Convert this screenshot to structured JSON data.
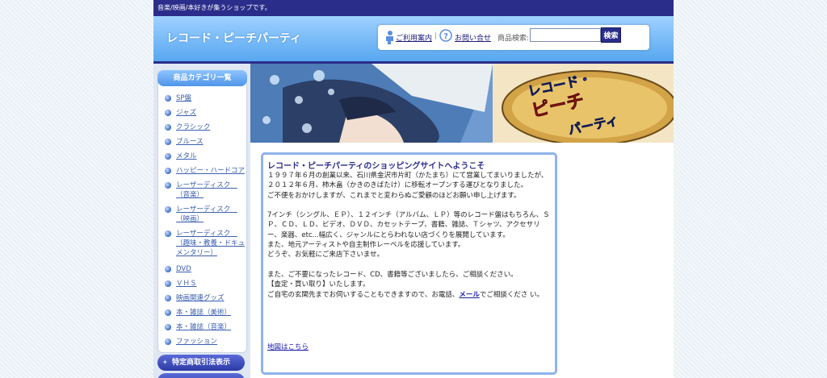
{
  "topbar": {
    "tagline": "音楽/映画/本好きが集うショップです。"
  },
  "header": {
    "logo": "レコード・ピーチパーティ",
    "guide_link": "ご利用案内",
    "contact_link": "お問い合せ",
    "search_label": "商品検索:",
    "search_value": "",
    "search_button": "検索"
  },
  "sidebar": {
    "category_title": "商品カテゴリ一覧",
    "items": [
      {
        "label": "SP盤"
      },
      {
        "label": "ジャズ"
      },
      {
        "label": "クラシック"
      },
      {
        "label": "ブルース"
      },
      {
        "label": "メタル"
      },
      {
        "label": "ハッピー・ハードコア"
      },
      {
        "label": "レーザーディスク　（音楽）"
      },
      {
        "label": "レーザーディスク　（映画）"
      },
      {
        "label": "レーザーディスク　（趣味・教養・ドキュメンタリー）"
      },
      {
        "label": "DVD"
      },
      {
        "label": "ＶＨＳ"
      },
      {
        "label": "映画関連グッズ"
      },
      {
        "label": "本・雑誌（美術）"
      },
      {
        "label": "本・雑誌（音楽）"
      },
      {
        "label": "ファッション"
      }
    ],
    "legal_button": "特定商取引法表示"
  },
  "banner": {
    "logo_text_1": "レコード・",
    "logo_text_2": "ピーチ",
    "logo_text_3": "パーティ"
  },
  "main": {
    "title": "レコード・ピーチパーティのショッピングサイトへようこそ",
    "p1_l1": "１９９７年６月の創業以来、石川県金沢市片町（かたまち）にて営業してまいりましたが、",
    "p1_l2": "２０１２年６月、柿木畠（かきのきばたけ）に移転オープンする運びとなりました。",
    "p1_l3": "ご不便をおかけしますが、これまでと変わらぬご愛顧のほどお願い申し上げます。",
    "p2_l1": "7インチ（シングル、ＥＰ）、１２インチ（アルバム、ＬＰ）等のレコード盤はもちろん、ＳＰ、ＣＤ、ＬＤ、ビデオ、ＤＶＤ、カセットテープ、書籍、雑誌、Ｔシャツ、アクセサリー、楽器、etc...幅広く、ジャンルにとらわれない店づくりを展開しています。",
    "p2_l2": "また、地元アーティストや自主制作レーベルを応援しています。",
    "p2_l3": "どうぞ、お気軽にご来店下さいませ。",
    "p3_l1": "また、ご不要になったレコード、CD、書籍等ございましたら、ご相談ください。",
    "p3_l2": "【査定・買い取り】いたします。",
    "p3_l3_pre": "ご自宅の玄関先までお伺いすることもできますので、お電話、",
    "p3_l3_link": "メール",
    "p3_l3_post": "でご相談くださ い。",
    "map_link": "地図はこちら"
  },
  "colors": {
    "brand_dark": "#2b2d8a",
    "header_blue": "#57a7f0",
    "link": "#3a5fb0"
  }
}
